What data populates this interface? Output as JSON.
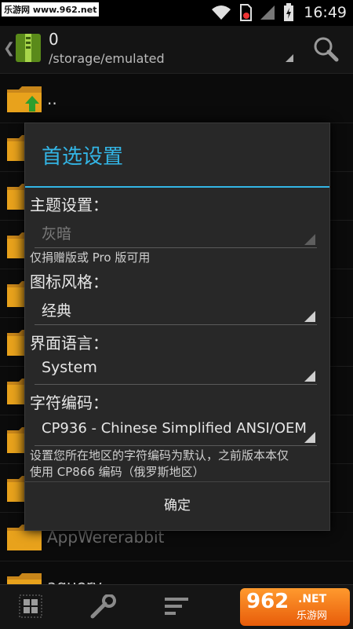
{
  "statusbar": {
    "watermark": "乐游网 www.962.net",
    "time": "16:49"
  },
  "header": {
    "title": "0",
    "path": "/storage/emulated"
  },
  "filelist": {
    "items": [
      {
        "name": ".."
      },
      {
        "name": ""
      },
      {
        "name": ""
      },
      {
        "name": ""
      },
      {
        "name": ""
      },
      {
        "name": ""
      },
      {
        "name": ""
      },
      {
        "name": ""
      },
      {
        "name": ""
      },
      {
        "name": "AppWererabbit"
      },
      {
        "name": "aquery"
      }
    ]
  },
  "dialog": {
    "title": "首选设置",
    "theme": {
      "label": "主题设置：",
      "value": "灰暗",
      "note": "仅捐赠版或 Pro 版可用"
    },
    "icon_style": {
      "label": "图标风格：",
      "value": "经典"
    },
    "ui_language": {
      "label": "界面语言：",
      "value": "System"
    },
    "charset": {
      "label": "字符编码：",
      "value": "CP936 - Chinese Simplified ANSI/OEM",
      "note_line1": "设置您所在地区的字符编码为默认，之前版本本仅",
      "note_line2": "使用 CP866 编码（俄罗斯地区）"
    },
    "ok_label": "确定"
  },
  "bottombar": {
    "logo_number": "962",
    "logo_suffix": ".NET",
    "logo_cn": "乐游网"
  },
  "colors": {
    "accent": "#33b5e5",
    "dialog_bg": "#282828",
    "folder": "#e8a21c"
  }
}
